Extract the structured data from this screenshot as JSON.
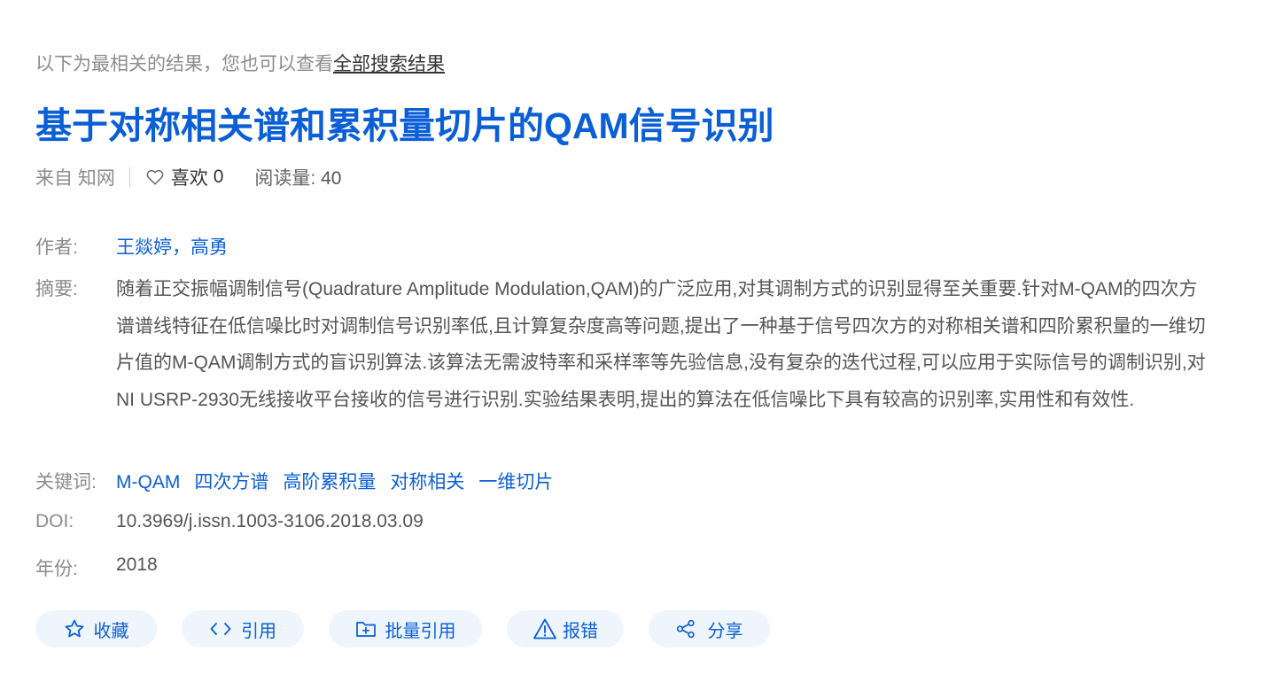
{
  "hint": {
    "prefix": "以下为最相关的结果，您也可以查看",
    "link": "全部搜索结果"
  },
  "title": "基于对称相关谱和累积量切片的QAM信号识别",
  "meta": {
    "source": "来自 知网",
    "like_label": "喜欢",
    "like_count": "0",
    "reads_label": "阅读量:",
    "reads_count": "40"
  },
  "fields": {
    "authors_label": "作者:",
    "authors": "王燚婷，高勇",
    "abstract_label": "摘要:",
    "abstract": "随着正交振幅调制信号(Quadrature Amplitude Modulation,QAM)的广泛应用,对其调制方式的识别显得至关重要.针对M-QAM的四次方谱谱线特征在低信噪比时对调制信号识别率低,且计算复杂度高等问题,提出了一种基于信号四次方的对称相关谱和四阶累积量的一维切片值的M-QAM调制方式的盲识别算法.该算法无需波特率和采样率等先验信息,没有复杂的迭代过程,可以应用于实际信号的调制识别,对NI USRP-2930无线接收平台接收的信号进行识别.实验结果表明,提出的算法在低信噪比下具有较高的识别率,实用性和有效性.",
    "keywords_label": "关键词:",
    "keywords": [
      "M-QAM",
      "四次方谱",
      "高阶累积量",
      "对称相关",
      "一维切片"
    ],
    "doi_label": "DOI:",
    "doi": "10.3969/j.issn.1003-3106.2018.03.09",
    "year_label": "年份:",
    "year": "2018"
  },
  "actions": {
    "favorite": "收藏",
    "cite": "引用",
    "batch_cite": "批量引用",
    "report": "报错",
    "share": "分享"
  },
  "icons": {
    "like": "heart-icon",
    "favorite": "star-icon",
    "cite": "code-brackets-icon",
    "batch_cite": "folder-plus-icon",
    "report": "warning-icon",
    "share": "share-icon"
  },
  "colors": {
    "accent": "#0b5fd6",
    "button_bg": "#eef5fd",
    "muted": "#8c8c8c"
  }
}
